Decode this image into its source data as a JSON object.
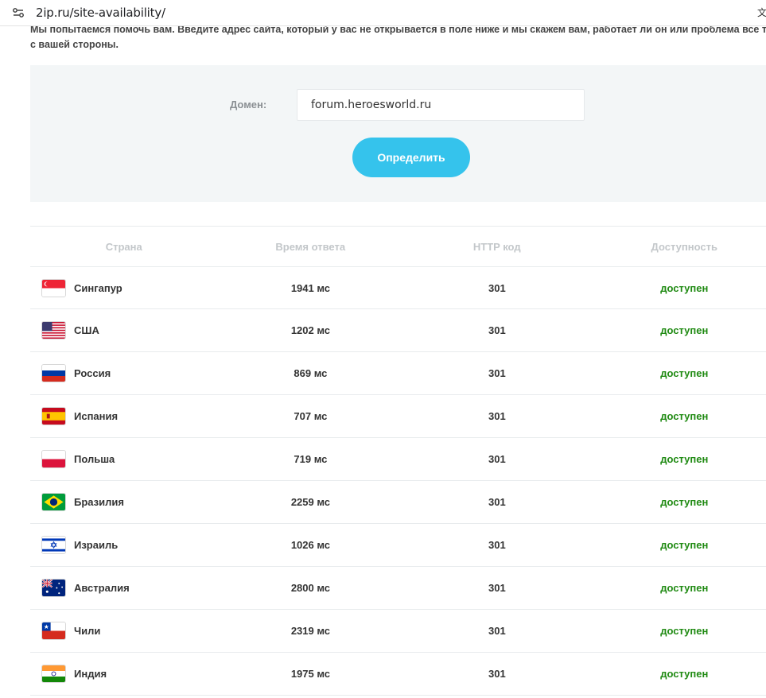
{
  "browser": {
    "url": "2ip.ru/site-availability/"
  },
  "intro": {
    "line1": "Мы попытаемся помочь вам. Введите адрес сайта, который у вас не открывается в поле ниже и мы скажем вам, работает ли он или проблема все т",
    "line2": "с вашей стороны."
  },
  "form": {
    "domain_label": "Домен:",
    "domain_value": "forum.heroesworld.ru",
    "submit_label": "Определить"
  },
  "table": {
    "headers": {
      "country": "Страна",
      "time": "Время ответа",
      "code": "HTTP код",
      "availability": "Доступность"
    },
    "rows": [
      {
        "country": "Сингапур",
        "flag": "sg-flag-icon",
        "time": "1941 мс",
        "code": "301",
        "availability": "доступен"
      },
      {
        "country": "США",
        "flag": "us-flag-icon",
        "time": "1202 мс",
        "code": "301",
        "availability": "доступен"
      },
      {
        "country": "Россия",
        "flag": "ru-flag-icon",
        "time": "869 мс",
        "code": "301",
        "availability": "доступен"
      },
      {
        "country": "Испания",
        "flag": "es-flag-icon",
        "time": "707 мс",
        "code": "301",
        "availability": "доступен"
      },
      {
        "country": "Польша",
        "flag": "pl-flag-icon",
        "time": "719 мс",
        "code": "301",
        "availability": "доступен"
      },
      {
        "country": "Бразилия",
        "flag": "br-flag-icon",
        "time": "2259 мс",
        "code": "301",
        "availability": "доступен"
      },
      {
        "country": "Израиль",
        "flag": "il-flag-icon",
        "time": "1026 мс",
        "code": "301",
        "availability": "доступен"
      },
      {
        "country": "Австралия",
        "flag": "au-flag-icon",
        "time": "2800 мс",
        "code": "301",
        "availability": "доступен"
      },
      {
        "country": "Чили",
        "flag": "cl-flag-icon",
        "time": "2319 мс",
        "code": "301",
        "availability": "доступен"
      },
      {
        "country": "Индия",
        "flag": "in-flag-icon",
        "time": "1975 мс",
        "code": "301",
        "availability": "доступен"
      }
    ]
  },
  "colors": {
    "accent": "#35c3ec",
    "available": "#1f8a12",
    "panel_bg": "#f3f6f7"
  }
}
